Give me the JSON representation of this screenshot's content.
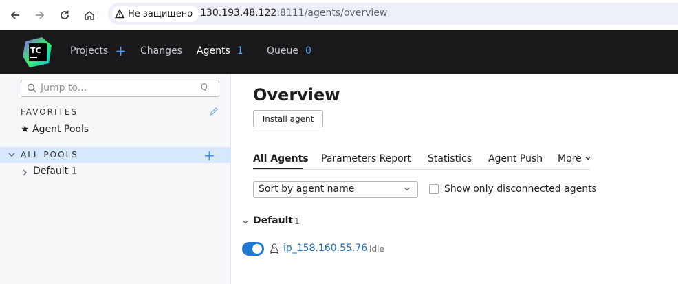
{
  "browser": {
    "security_label": "Не защищено",
    "url_host": "130.193.48.122",
    "url_rest": ":8111/agents/overview",
    "icons": [
      "back-icon",
      "forward-icon",
      "reload-icon",
      "home-icon",
      "warning-icon"
    ]
  },
  "header": {
    "logo_text": "TC",
    "nav": {
      "projects": "Projects",
      "changes": "Changes",
      "agents": "Agents",
      "agents_count": "1",
      "queue": "Queue",
      "queue_count": "0"
    }
  },
  "sidebar": {
    "search_placeholder": "Jump to...",
    "search_hint": "Q",
    "favorites_title": "FAVORITES",
    "favorite_item": "Agent Pools",
    "all_pools_title": "ALL POOLS",
    "pools": [
      {
        "name": "Default",
        "count": "1"
      }
    ]
  },
  "main": {
    "title": "Overview",
    "install_button": "Install agent",
    "tabs": [
      "All Agents",
      "Parameters Report",
      "Statistics",
      "Agent Push",
      "More"
    ],
    "sort_select": "Sort by agent name",
    "disconnected_checkbox_label": "Show only disconnected agents",
    "group": {
      "name": "Default",
      "count": "1"
    },
    "agents": [
      {
        "name": "ip_158.160.55.76",
        "status": "Idle",
        "enabled": true
      }
    ]
  },
  "colors": {
    "header_bg": "#19191c",
    "accent": "#4da3ff",
    "sidebar_selected": "#d6e8fb",
    "toggle_on": "#1f79d1",
    "link": "#1a6cc0"
  }
}
